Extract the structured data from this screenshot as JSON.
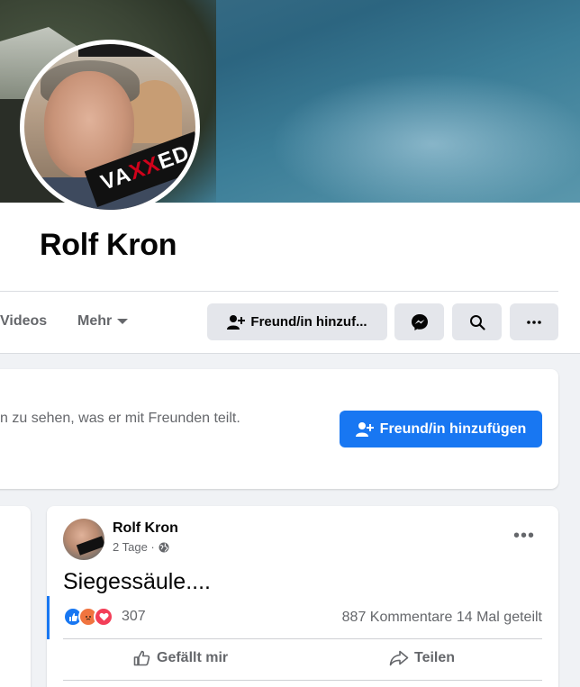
{
  "profile": {
    "name": "Rolf Kron",
    "avatar_sign_text": "VAXXED"
  },
  "tabs": {
    "videos": "Videos",
    "more": "Mehr"
  },
  "actions": {
    "add_friend": "Freund/in hinzuf...",
    "messenger_icon": "messenger-icon",
    "search_icon": "search-icon",
    "more_icon": "more-icon"
  },
  "friend_prompt": {
    "text": "n zu sehen, was er mit Freunden teilt.",
    "button": "Freund/in hinzufügen"
  },
  "post": {
    "author": "Rolf Kron",
    "time": "2 Tage ·",
    "text": "Siegessäule....",
    "reactions_count": "307",
    "comments": "887 Kommentare",
    "shares": "14 Mal geteilt",
    "like_label": "Gefällt mir",
    "share_label": "Teilen"
  },
  "colors": {
    "brand_blue": "#1877f2",
    "gray_button": "#e4e6eb",
    "secondary_text": "#65676b"
  }
}
